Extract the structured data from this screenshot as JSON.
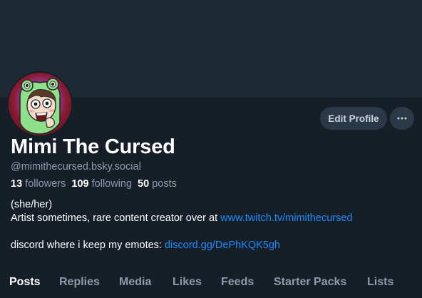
{
  "profile": {
    "display_name": "Mimi The Cursed",
    "handle": "@mimithecursed.bsky.social",
    "edit_profile_label": "Edit Profile",
    "stats": {
      "followers_count": "13",
      "followers_label": "followers",
      "following_count": "109",
      "following_label": "following",
      "posts_count": "50",
      "posts_label": "posts"
    },
    "bio": {
      "line1": "(she/her)",
      "line2_text": "Artist sometimes, rare content creator over at ",
      "line2_link": "www.twitch.tv/mimithecursed",
      "line3_text": "discord where i keep my emotes: ",
      "line3_link": "discord.gg/DePhKQK5gh"
    }
  },
  "tabs": [
    {
      "label": "Posts",
      "active": true
    },
    {
      "label": "Replies",
      "active": false
    },
    {
      "label": "Media",
      "active": false
    },
    {
      "label": "Likes",
      "active": false
    },
    {
      "label": "Feeds",
      "active": false
    },
    {
      "label": "Starter Packs",
      "active": false
    },
    {
      "label": "Lists",
      "active": false
    }
  ],
  "icons": {
    "more": "more-horizontal-icon",
    "avatar": "frog-hood-avatar"
  },
  "colors": {
    "background": "#161e27",
    "banner": "#1e2936",
    "link": "#208bfe",
    "muted": "#8d9bab",
    "button": "#2b3847"
  }
}
